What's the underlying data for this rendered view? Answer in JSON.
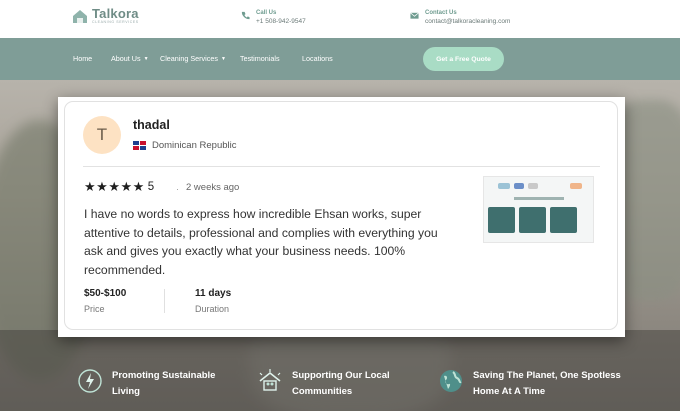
{
  "header": {
    "logo_name": "Talkora",
    "logo_sub": "Cleaning Services",
    "call_label": "Call Us",
    "call_value": "+1 508-942-9547",
    "mail_label": "Contact Us",
    "mail_value": "contact@talkoracleaning.com"
  },
  "nav": {
    "items": [
      {
        "label": "Home"
      },
      {
        "label": "About Us"
      },
      {
        "label": "Cleaning Services"
      },
      {
        "label": "Testimonials"
      },
      {
        "label": "Locations"
      }
    ],
    "cta": "Get a Free Quote"
  },
  "review": {
    "avatar_letter": "T",
    "name": "thadal",
    "country": "Dominican Republic",
    "rating": "5",
    "stars": 5,
    "time_ago": "2 weeks ago",
    "text": "I have no words to express how incredible Ehsan works, super attentive to details, professional and complies with everything you ask and gives you exactly what your business needs. 100% recommended.",
    "price_value": "$50-$100",
    "price_label": "Price",
    "duration_value": "11 days",
    "duration_label": "Duration"
  },
  "features": [
    {
      "text": "Promoting Sustainable Living",
      "icon": "leaf-bolt-icon"
    },
    {
      "text": "Supporting Our Local Communities",
      "icon": "community-icon"
    },
    {
      "text": "Saving The Planet, One Spotless Home At A Time",
      "icon": "globe-icon"
    }
  ],
  "colors": {
    "accent": "#7f9d97",
    "cta": "#a9dcc5",
    "avatar_bg": "#fde2c3"
  }
}
